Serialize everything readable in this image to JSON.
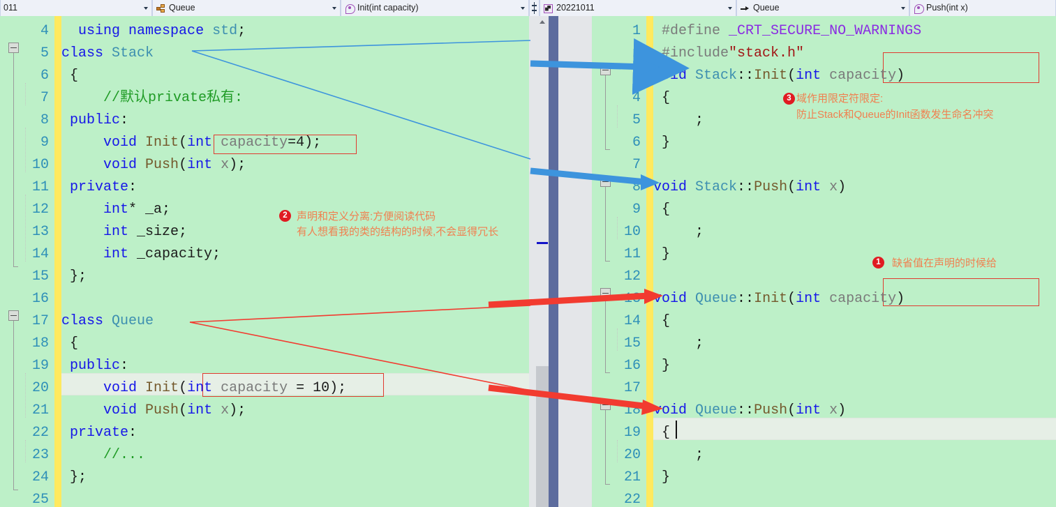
{
  "navbar": {
    "left": {
      "project": {
        "icon": "project-icon",
        "label": "011"
      },
      "class": {
        "icon": "class-icon",
        "label": "Queue"
      },
      "member": {
        "icon": "method-icon",
        "label": "Init(int capacity)"
      },
      "split_icon": "split-window-icon"
    },
    "right": {
      "project": {
        "icon": "project-icon",
        "label": "20221011"
      },
      "class": {
        "icon": "arrow-icon",
        "label": "Queue"
      },
      "member": {
        "icon": "method-icon",
        "label": "Push(int x)"
      }
    }
  },
  "left_editor": {
    "first_line_number": 4,
    "current_line": 20,
    "lines": [
      {
        "n": 4,
        "tokens": [
          {
            "t": "  ",
            "c": "pun"
          },
          {
            "t": "using",
            "c": "kw"
          },
          {
            "t": " ",
            "c": "pun"
          },
          {
            "t": "namespace",
            "c": "kw"
          },
          {
            "t": " ",
            "c": "pun"
          },
          {
            "t": "std",
            "c": "typ"
          },
          {
            "t": ";",
            "c": "pun"
          }
        ]
      },
      {
        "n": 5,
        "tokens": [
          {
            "t": "class",
            "c": "kw"
          },
          {
            "t": " ",
            "c": "pun"
          },
          {
            "t": "Stack",
            "c": "typ"
          }
        ]
      },
      {
        "n": 6,
        "tokens": [
          {
            "t": " {",
            "c": "pun"
          }
        ]
      },
      {
        "n": 7,
        "tokens": [
          {
            "t": "     //默认private私有:",
            "c": "cmt"
          }
        ]
      },
      {
        "n": 8,
        "tokens": [
          {
            "t": " ",
            "c": "pun"
          },
          {
            "t": "public",
            "c": "kw"
          },
          {
            "t": ":",
            "c": "pun"
          }
        ]
      },
      {
        "n": 9,
        "tokens": [
          {
            "t": "     ",
            "c": "pun"
          },
          {
            "t": "void",
            "c": "kw"
          },
          {
            "t": " ",
            "c": "pun"
          },
          {
            "t": "Init",
            "c": "fn"
          },
          {
            "t": "(",
            "c": "pun"
          },
          {
            "t": "int",
            "c": "kw"
          },
          {
            "t": " ",
            "c": "pun"
          },
          {
            "t": "capacity",
            "c": "par"
          },
          {
            "t": "=",
            "c": "pun"
          },
          {
            "t": "4",
            "c": "num"
          },
          {
            "t": ");",
            "c": "pun"
          }
        ]
      },
      {
        "n": 10,
        "tokens": [
          {
            "t": "     ",
            "c": "pun"
          },
          {
            "t": "void",
            "c": "kw"
          },
          {
            "t": " ",
            "c": "pun"
          },
          {
            "t": "Push",
            "c": "fn"
          },
          {
            "t": "(",
            "c": "pun"
          },
          {
            "t": "int",
            "c": "kw"
          },
          {
            "t": " ",
            "c": "pun"
          },
          {
            "t": "x",
            "c": "par"
          },
          {
            "t": ");",
            "c": "pun"
          }
        ]
      },
      {
        "n": 11,
        "tokens": [
          {
            "t": " ",
            "c": "pun"
          },
          {
            "t": "private",
            "c": "kw"
          },
          {
            "t": ":",
            "c": "pun"
          }
        ]
      },
      {
        "n": 12,
        "tokens": [
          {
            "t": "     ",
            "c": "pun"
          },
          {
            "t": "int",
            "c": "kw"
          },
          {
            "t": "* _a;",
            "c": "pun"
          }
        ]
      },
      {
        "n": 13,
        "tokens": [
          {
            "t": "     ",
            "c": "pun"
          },
          {
            "t": "int",
            "c": "kw"
          },
          {
            "t": " _size;",
            "c": "pun"
          }
        ]
      },
      {
        "n": 14,
        "tokens": [
          {
            "t": "     ",
            "c": "pun"
          },
          {
            "t": "int",
            "c": "kw"
          },
          {
            "t": " _capacity;",
            "c": "pun"
          }
        ]
      },
      {
        "n": 15,
        "tokens": [
          {
            "t": " };",
            "c": "pun"
          }
        ]
      },
      {
        "n": 16,
        "tokens": []
      },
      {
        "n": 17,
        "tokens": [
          {
            "t": "class",
            "c": "kw"
          },
          {
            "t": " ",
            "c": "pun"
          },
          {
            "t": "Queue",
            "c": "typ"
          }
        ]
      },
      {
        "n": 18,
        "tokens": [
          {
            "t": " {",
            "c": "pun"
          }
        ]
      },
      {
        "n": 19,
        "tokens": [
          {
            "t": " ",
            "c": "pun"
          },
          {
            "t": "public",
            "c": "kw"
          },
          {
            "t": ":",
            "c": "pun"
          }
        ]
      },
      {
        "n": 20,
        "tokens": [
          {
            "t": "     ",
            "c": "pun"
          },
          {
            "t": "void",
            "c": "kw"
          },
          {
            "t": " ",
            "c": "pun"
          },
          {
            "t": "Init",
            "c": "fn"
          },
          {
            "t": "(",
            "c": "pun"
          },
          {
            "t": "int",
            "c": "kw"
          },
          {
            "t": " ",
            "c": "pun"
          },
          {
            "t": "capacity",
            "c": "par"
          },
          {
            "t": " = ",
            "c": "pun"
          },
          {
            "t": "10",
            "c": "num"
          },
          {
            "t": ");",
            "c": "pun"
          }
        ]
      },
      {
        "n": 21,
        "tokens": [
          {
            "t": "     ",
            "c": "pun"
          },
          {
            "t": "void",
            "c": "kw"
          },
          {
            "t": " ",
            "c": "pun"
          },
          {
            "t": "Push",
            "c": "fn"
          },
          {
            "t": "(",
            "c": "pun"
          },
          {
            "t": "int",
            "c": "kw"
          },
          {
            "t": " ",
            "c": "pun"
          },
          {
            "t": "x",
            "c": "par"
          },
          {
            "t": ");",
            "c": "pun"
          }
        ]
      },
      {
        "n": 22,
        "tokens": [
          {
            "t": " ",
            "c": "pun"
          },
          {
            "t": "private",
            "c": "kw"
          },
          {
            "t": ":",
            "c": "pun"
          }
        ]
      },
      {
        "n": 23,
        "tokens": [
          {
            "t": "     //...",
            "c": "cmt"
          }
        ]
      },
      {
        "n": 24,
        "tokens": [
          {
            "t": " };",
            "c": "pun"
          }
        ]
      },
      {
        "n": 25,
        "tokens": []
      }
    ]
  },
  "right_editor": {
    "first_line_number": 1,
    "current_line": 19,
    "lines": [
      {
        "n": 1,
        "tokens": [
          {
            "t": " ",
            "c": "pun"
          },
          {
            "t": "#define",
            "c": "pp"
          },
          {
            "t": " ",
            "c": "pun"
          },
          {
            "t": "_CRT_SECURE_NO_WARNINGS",
            "c": "macro"
          }
        ]
      },
      {
        "n": 2,
        "tokens": [
          {
            "t": " ",
            "c": "pun"
          },
          {
            "t": "#include",
            "c": "pp"
          },
          {
            "t": "\"stack.h\"",
            "c": "str"
          }
        ]
      },
      {
        "n": 3,
        "tokens": [
          {
            "t": "void",
            "c": "kw"
          },
          {
            "t": " ",
            "c": "pun"
          },
          {
            "t": "Stack",
            "c": "typ"
          },
          {
            "t": "::",
            "c": "pun"
          },
          {
            "t": "Init",
            "c": "fn"
          },
          {
            "t": "(",
            "c": "pun"
          },
          {
            "t": "int",
            "c": "kw"
          },
          {
            "t": " ",
            "c": "pun"
          },
          {
            "t": "capacity",
            "c": "par"
          },
          {
            "t": ")",
            "c": "pun"
          }
        ]
      },
      {
        "n": 4,
        "tokens": [
          {
            "t": " {",
            "c": "pun"
          }
        ]
      },
      {
        "n": 5,
        "tokens": [
          {
            "t": "     ;",
            "c": "pun"
          }
        ]
      },
      {
        "n": 6,
        "tokens": [
          {
            "t": " }",
            "c": "pun"
          }
        ]
      },
      {
        "n": 7,
        "tokens": []
      },
      {
        "n": 8,
        "tokens": [
          {
            "t": "void",
            "c": "kw"
          },
          {
            "t": " ",
            "c": "pun"
          },
          {
            "t": "Stack",
            "c": "typ"
          },
          {
            "t": "::",
            "c": "pun"
          },
          {
            "t": "Push",
            "c": "fn"
          },
          {
            "t": "(",
            "c": "pun"
          },
          {
            "t": "int",
            "c": "kw"
          },
          {
            "t": " ",
            "c": "pun"
          },
          {
            "t": "x",
            "c": "par"
          },
          {
            "t": ")",
            "c": "pun"
          }
        ]
      },
      {
        "n": 9,
        "tokens": [
          {
            "t": " {",
            "c": "pun"
          }
        ]
      },
      {
        "n": 10,
        "tokens": [
          {
            "t": "     ;",
            "c": "pun"
          }
        ]
      },
      {
        "n": 11,
        "tokens": [
          {
            "t": " }",
            "c": "pun"
          }
        ]
      },
      {
        "n": 12,
        "tokens": []
      },
      {
        "n": 13,
        "tokens": [
          {
            "t": "void",
            "c": "kw"
          },
          {
            "t": " ",
            "c": "pun"
          },
          {
            "t": "Queue",
            "c": "typ"
          },
          {
            "t": "::",
            "c": "pun"
          },
          {
            "t": "Init",
            "c": "fn"
          },
          {
            "t": "(",
            "c": "pun"
          },
          {
            "t": "int",
            "c": "kw"
          },
          {
            "t": " ",
            "c": "pun"
          },
          {
            "t": "capacity",
            "c": "par"
          },
          {
            "t": ")",
            "c": "pun"
          }
        ]
      },
      {
        "n": 14,
        "tokens": [
          {
            "t": " {",
            "c": "pun"
          }
        ]
      },
      {
        "n": 15,
        "tokens": [
          {
            "t": "     ;",
            "c": "pun"
          }
        ]
      },
      {
        "n": 16,
        "tokens": [
          {
            "t": " }",
            "c": "pun"
          }
        ]
      },
      {
        "n": 17,
        "tokens": []
      },
      {
        "n": 18,
        "tokens": [
          {
            "t": "void",
            "c": "kw"
          },
          {
            "t": " ",
            "c": "pun"
          },
          {
            "t": "Queue",
            "c": "typ"
          },
          {
            "t": "::",
            "c": "pun"
          },
          {
            "t": "Push",
            "c": "fn"
          },
          {
            "t": "(",
            "c": "pun"
          },
          {
            "t": "int",
            "c": "kw"
          },
          {
            "t": " ",
            "c": "pun"
          },
          {
            "t": "x",
            "c": "par"
          },
          {
            "t": ")",
            "c": "pun"
          }
        ]
      },
      {
        "n": 19,
        "tokens": [
          {
            "t": " {",
            "c": "pun"
          }
        ]
      },
      {
        "n": 20,
        "tokens": [
          {
            "t": "     ;",
            "c": "pun"
          }
        ]
      },
      {
        "n": 21,
        "tokens": [
          {
            "t": " }",
            "c": "pun"
          }
        ]
      },
      {
        "n": 22,
        "tokens": []
      }
    ]
  },
  "annotations": [
    {
      "id": "1",
      "badge": "1",
      "lines": [
        "缺省值在声明的时候给"
      ]
    },
    {
      "id": "2",
      "badge": "2",
      "lines": [
        "声明和定义分离:方便阅读代码",
        "有人想看我的类的结构的时候,不会显得冗长"
      ]
    },
    {
      "id": "3",
      "badge": "3",
      "lines": [
        "域作用限定符限定:",
        "防止Stack和Queue的Init函数发生命名冲突"
      ]
    }
  ],
  "colors": {
    "editor_background": "#bdf0c8",
    "line_number": "#2e8fb8",
    "change_bar": "#ffe95e",
    "annotation_text": "#f08050",
    "badge_background": "#e01b22",
    "emphasis_box": "#e03a2f",
    "blue_arrow": "#3d94dd",
    "red_arrow": "#f23b30",
    "splitter": "#5d6c9e"
  }
}
